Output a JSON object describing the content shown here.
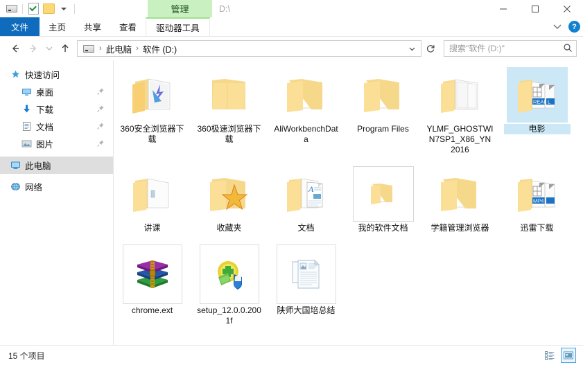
{
  "window": {
    "title": "D:\\",
    "contextual_tab": "管理",
    "controls": {
      "minimize": "最小化",
      "maximize": "最大化",
      "close": "关闭"
    }
  },
  "quick_access_toolbar": {
    "items": [
      {
        "icon": "drive-icon",
        "label": "驱动器"
      },
      {
        "icon": "properties-icon",
        "label": "属性"
      },
      {
        "icon": "new-folder-icon",
        "label": "新建文件夹"
      },
      {
        "icon": "chevron-down-icon",
        "label": "自定义快速访问工具栏"
      }
    ]
  },
  "ribbon": {
    "tabs": [
      {
        "label": "文件",
        "type": "file"
      },
      {
        "label": "主页",
        "type": "normal"
      },
      {
        "label": "共享",
        "type": "normal"
      },
      {
        "label": "查看",
        "type": "normal"
      },
      {
        "label": "驱动器工具",
        "type": "contextual"
      }
    ],
    "collapse_icon": "chevron-up-icon",
    "help_label": "?"
  },
  "address_bar": {
    "back": "后退",
    "forward": "前进",
    "recent": "最近浏览的位置",
    "up": "上移一级",
    "breadcrumb": [
      "此电脑",
      "软件 (D:)"
    ],
    "breadcrumb_sep": "›",
    "dropdown_icon": "chevron-down-icon",
    "refresh_icon": "refresh-icon",
    "refresh_label": "刷新"
  },
  "search": {
    "placeholder": "搜索\"软件 (D:)\"",
    "value": "",
    "icon": "search-icon"
  },
  "sidebar": {
    "groups": [
      {
        "label": "快速访问",
        "icon": "star-pin-icon",
        "selected": false,
        "pinned": false,
        "children": [
          {
            "label": "桌面",
            "icon": "desktop-icon",
            "pinned": true
          },
          {
            "label": "下载",
            "icon": "download-icon",
            "pinned": true
          },
          {
            "label": "文档",
            "icon": "documents-icon",
            "pinned": true
          },
          {
            "label": "图片",
            "icon": "pictures-icon",
            "pinned": true
          }
        ]
      },
      {
        "label": "此电脑",
        "icon": "this-pc-icon",
        "selected": true,
        "pinned": false,
        "children": []
      },
      {
        "label": "网络",
        "icon": "network-icon",
        "selected": false,
        "pinned": false,
        "children": []
      }
    ]
  },
  "files": {
    "rows": [
      [
        {
          "name": "360安全浏览器下载",
          "icon": "folder-browser-icon",
          "type": "folder",
          "state": "normal"
        },
        {
          "name": "360极速浏览器下载",
          "icon": "folder-plain-icon",
          "type": "folder",
          "state": "normal"
        },
        {
          "name": "AliWorkbenchData",
          "icon": "folder-docs-icon",
          "type": "folder",
          "state": "normal"
        },
        {
          "name": "Program Files",
          "icon": "folder-docs-icon",
          "type": "folder",
          "state": "normal"
        },
        {
          "name": "YLMF_GHOSTWIN7SP1_X86_YN2016",
          "icon": "folder-white-icon",
          "type": "folder",
          "state": "normal"
        },
        {
          "name": "电影",
          "icon": "folder-media-icon",
          "type": "folder",
          "state": "selected"
        }
      ],
      [
        {
          "name": "讲课",
          "icon": "folder-open-icon",
          "type": "folder",
          "state": "normal"
        },
        {
          "name": "收藏夹",
          "icon": "folder-favorites-icon",
          "type": "folder",
          "state": "normal"
        },
        {
          "name": "文档",
          "icon": "folder-doc-a-icon",
          "type": "folder",
          "state": "normal"
        },
        {
          "name": "我的软件文档",
          "icon": "folder-small-icon",
          "type": "folder",
          "state": "focus"
        },
        {
          "name": "学籍管理浏览器",
          "icon": "folder-docs-icon",
          "type": "folder",
          "state": "normal"
        },
        {
          "name": "迅雷下载",
          "icon": "folder-mp4-icon",
          "type": "folder",
          "state": "normal"
        }
      ],
      [
        {
          "name": "chrome.ext",
          "icon": "winrar-archive-icon",
          "type": "file",
          "state": "normal"
        },
        {
          "name": "setup_12.0.0.2001f",
          "icon": "installer-shield-icon",
          "type": "file",
          "state": "normal"
        },
        {
          "name": "陕师大国培总结",
          "icon": "document-file-icon",
          "type": "file",
          "state": "normal"
        }
      ]
    ]
  },
  "status_bar": {
    "item_count_text": "15 个项目",
    "views": [
      {
        "icon": "details-view-icon",
        "label": "详细信息",
        "active": false
      },
      {
        "icon": "large-icons-view-icon",
        "label": "大图标",
        "active": true
      }
    ]
  },
  "colors": {
    "file_tab": "#0f6cbd",
    "contextual_tab": "#c8f0c0",
    "selection": "#cce8f6",
    "sidebar_selection": "#dedede",
    "folder": "#fcd975"
  }
}
